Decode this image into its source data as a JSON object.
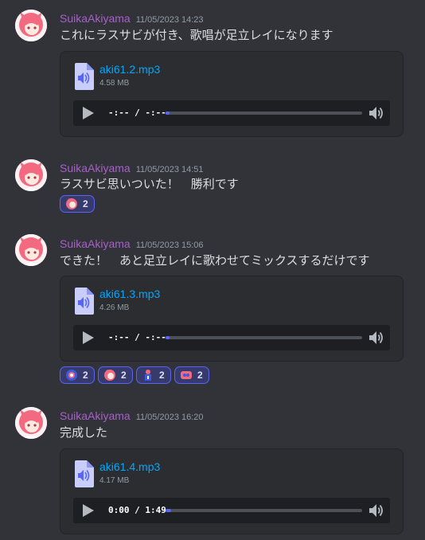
{
  "messages": [
    {
      "username": "SuikaAkiyama",
      "timestamp": "11/05/2023 14:23",
      "text": "これにラスサビが付き、歌唱が足立レイになります",
      "attachment": {
        "file_name": "aki61.2.mp3",
        "file_size": "4.58 MB",
        "time_display": "-:-- / -:--",
        "progress": 0.02
      }
    },
    {
      "username": "SuikaAkiyama",
      "timestamp": "11/05/2023 14:51",
      "text": "ラスサビ思いついた！　勝利です",
      "reactions": [
        {
          "emoji": "custom-character-emoji-a",
          "count": "2"
        }
      ]
    },
    {
      "username": "SuikaAkiyama",
      "timestamp": "11/05/2023 15:06",
      "text": "できた！　あと足立レイに歌わせてミックスするだけです",
      "attachment": {
        "file_name": "aki61.3.mp3",
        "file_size": "4.26 MB",
        "time_display": "-:-- / -:--",
        "progress": 0.02
      },
      "reactions": [
        {
          "emoji": "custom-character-emoji-b",
          "count": "2"
        },
        {
          "emoji": "custom-character-emoji-a",
          "count": "2"
        },
        {
          "emoji": "custom-character-emoji-c",
          "count": "2"
        },
        {
          "emoji": "custom-character-emoji-d",
          "count": "2"
        }
      ]
    },
    {
      "username": "SuikaAkiyama",
      "timestamp": "11/05/2023 16:20",
      "text": "完成した",
      "attachment": {
        "file_name": "aki61.4.mp3",
        "file_size": "4.17 MB",
        "time_display": "0:00 / 1:49",
        "progress": 0.03
      }
    }
  ],
  "colors": {
    "background": "#313338",
    "username": "#a561c6",
    "link": "#00a8fc",
    "reaction_bg": "#373a6d",
    "reaction_border": "#5865f2",
    "accent": "#5865f2"
  }
}
